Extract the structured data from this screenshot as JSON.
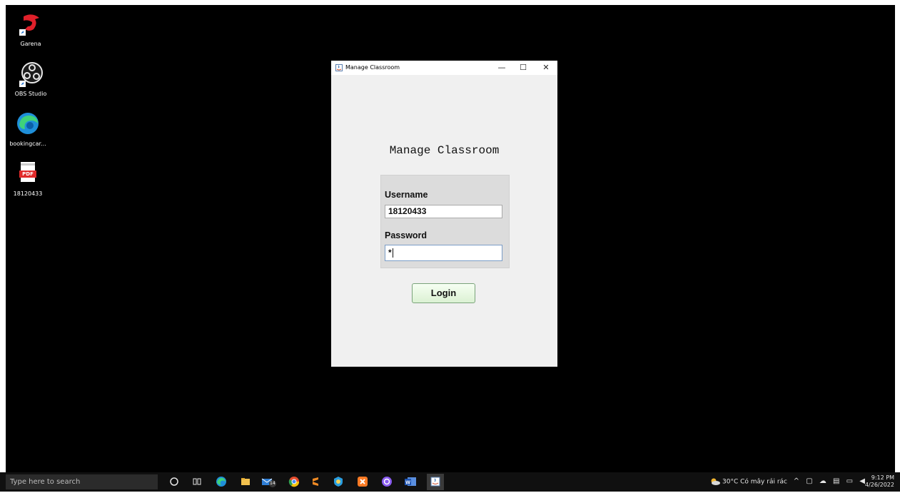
{
  "desktop": {
    "icons": [
      {
        "label": "Garena"
      },
      {
        "label": "OBS Studio"
      },
      {
        "label": "bookingcar..."
      },
      {
        "label": "18120433",
        "badge": "PDF"
      }
    ]
  },
  "window": {
    "title": "Manage Classroom",
    "controls": {
      "minimize": "—",
      "maximize": "☐",
      "close": "✕"
    }
  },
  "form": {
    "heading": "Manage Classroom",
    "username_label": "Username",
    "username_value": "18120433",
    "password_label": "Password",
    "password_value": "*",
    "login_label": "Login"
  },
  "taskbar": {
    "search_placeholder": "Type here to search",
    "mail_badge": "14",
    "weather": "30°C  Có mây rải rác",
    "time": "9:12 PM",
    "date": "4/26/2022"
  },
  "colors": {
    "desktop": "#000000",
    "taskbar": "#101010",
    "window_bg": "#f0f0f0",
    "login_button": "#dbf1d3"
  }
}
